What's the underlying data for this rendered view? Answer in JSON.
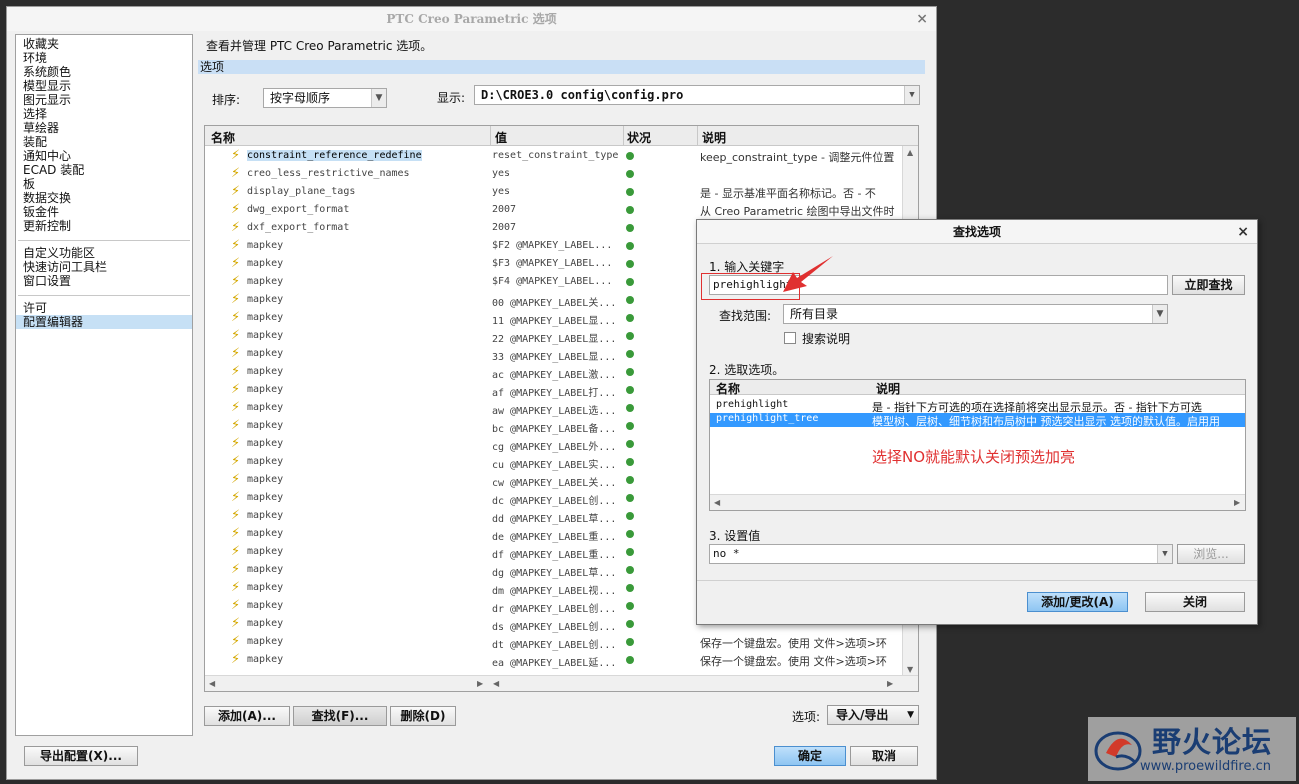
{
  "main": {
    "title": "PTC Creo Parametric 选项",
    "close": "×",
    "categories_group1": [
      "收藏夹",
      "环境",
      "系统颜色",
      "模型显示",
      "图元显示",
      "选择",
      "草绘器",
      "装配",
      "通知中心",
      "ECAD 装配",
      "板",
      "数据交换",
      "钣金件",
      "更新控制"
    ],
    "categories_group2": [
      "自定义功能区",
      "快速访问工具栏",
      "窗口设置"
    ],
    "categories_group3": [
      "许可",
      "配置编辑器"
    ],
    "selected_category": "配置编辑器",
    "description": "查看并管理 PTC Creo Parametric 选项。",
    "section": "选项",
    "sort_label": "排序:",
    "sort_value": "按字母顺序",
    "show_label": "显示:",
    "show_value": "D:\\CROE3.0 config\\config.pro",
    "columns": [
      "名称",
      "值",
      "状况",
      "说明"
    ],
    "rows": [
      {
        "name": "constraint_reference_redefine",
        "value": "reset_constraint_type",
        "desc": "keep_constraint_type - 调整元件位置"
      },
      {
        "name": "creo_less_restrictive_names",
        "value": "yes",
        "desc": ""
      },
      {
        "name": "display_plane_tags",
        "value": "yes",
        "desc": "是 - 显示基准平面名称标记。否 - 不"
      },
      {
        "name": "dwg_export_format",
        "value": "2007",
        "desc": "从 Creo Parametric 绘图中导出文件时"
      },
      {
        "name": "dxf_export_format",
        "value": "2007",
        "desc": ""
      },
      {
        "name": "mapkey",
        "value": "$F2 @MAPKEY_LABEL...",
        "desc": ""
      },
      {
        "name": "mapkey",
        "value": "$F3 @MAPKEY_LABEL...",
        "desc": ""
      },
      {
        "name": "mapkey",
        "value": "$F4 @MAPKEY_LABEL...",
        "desc": ""
      },
      {
        "name": "mapkey",
        "value": "00 @MAPKEY_LABEL关...",
        "desc": ""
      },
      {
        "name": "mapkey",
        "value": "11 @MAPKEY_LABEL显...",
        "desc": ""
      },
      {
        "name": "mapkey",
        "value": "22 @MAPKEY_LABEL显...",
        "desc": ""
      },
      {
        "name": "mapkey",
        "value": "33 @MAPKEY_LABEL显...",
        "desc": ""
      },
      {
        "name": "mapkey",
        "value": "ac @MAPKEY_LABEL激...",
        "desc": ""
      },
      {
        "name": "mapkey",
        "value": "af @MAPKEY_LABEL打...",
        "desc": ""
      },
      {
        "name": "mapkey",
        "value": "aw @MAPKEY_LABEL选...",
        "desc": ""
      },
      {
        "name": "mapkey",
        "value": "bc @MAPKEY_LABEL备...",
        "desc": ""
      },
      {
        "name": "mapkey",
        "value": "cg @MAPKEY_LABEL外...",
        "desc": ""
      },
      {
        "name": "mapkey",
        "value": "cu @MAPKEY_LABEL实...",
        "desc": ""
      },
      {
        "name": "mapkey",
        "value": "cw @MAPKEY_LABEL关...",
        "desc": ""
      },
      {
        "name": "mapkey",
        "value": "dc @MAPKEY_LABEL创...",
        "desc": ""
      },
      {
        "name": "mapkey",
        "value": "dd @MAPKEY_LABEL草...",
        "desc": ""
      },
      {
        "name": "mapkey",
        "value": "de @MAPKEY_LABEL重...",
        "desc": ""
      },
      {
        "name": "mapkey",
        "value": "df @MAPKEY_LABEL重...",
        "desc": ""
      },
      {
        "name": "mapkey",
        "value": "dg @MAPKEY_LABEL草...",
        "desc": ""
      },
      {
        "name": "mapkey",
        "value": "dm @MAPKEY_LABEL视...",
        "desc": ""
      },
      {
        "name": "mapkey",
        "value": "dr @MAPKEY_LABEL创...",
        "desc": ""
      },
      {
        "name": "mapkey",
        "value": "ds @MAPKEY_LABEL创...",
        "desc": ""
      },
      {
        "name": "mapkey",
        "value": "dt @MAPKEY_LABEL创...",
        "desc": "保存一个键盘宏。使用 文件>选项>环"
      },
      {
        "name": "mapkey",
        "value": "ea @MAPKEY_LABEL延...",
        "desc": "保存一个键盘宏。使用 文件>选项>环"
      }
    ],
    "add_btn": "添加(A)...",
    "find_btn": "查找(F)...",
    "delete_btn": "删除(D)",
    "options_label": "选项:",
    "import_export": "导入/导出",
    "export_config": "导出配置(X)...",
    "ok": "确定",
    "cancel": "取消"
  },
  "find": {
    "title": "查找选项",
    "close": "×",
    "step1": "1.  输入关键字",
    "keyword": "prehighlight",
    "search_now": "立即查找",
    "scope_label": "查找范围:",
    "scope_value": "所有目录",
    "search_desc": "搜索说明",
    "step2": "2.  选取选项。",
    "col_name": "名称",
    "col_desc": "说明",
    "results": [
      {
        "name": "prehighlight",
        "desc": "是 - 指针下方可选的项在选择前将突出显示显示。否 - 指针下方可选"
      },
      {
        "name": "prehighlight_tree",
        "desc": "模型树、层树、细节树和布局树中 预选突出显示 选项的默认值。启用用"
      }
    ],
    "annotation": "选择NO就能默认关闭预选加亮",
    "step3": "3.  设置值",
    "value": "no *",
    "browse": "浏览...",
    "add_change": "添加/更改(A)",
    "close_btn": "关闭"
  },
  "watermark": {
    "name": "野火论坛",
    "url": "www.proewildfire.cn"
  },
  "colors": {
    "selection": "#c6e0f5",
    "result_selected": "#3399ff",
    "annotation": "#e03030",
    "primary_button": "#8ec5f2"
  }
}
